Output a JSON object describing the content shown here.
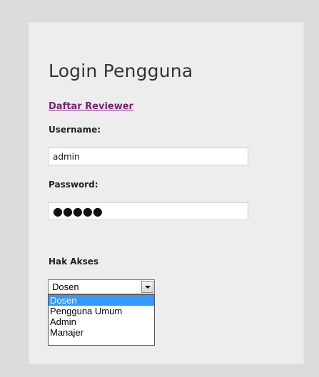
{
  "login": {
    "title": "Login Pengguna",
    "register_link": "Daftar Reviewer",
    "username_label": "Username:",
    "username_value": "admin",
    "password_label": "Password:",
    "password_mask": "●●●●●",
    "role_label": "Hak Akses",
    "role_selected": "Dosen",
    "role_options": [
      "Dosen",
      "Pengguna Umum",
      "Admin",
      "Manajer"
    ]
  },
  "colors": {
    "page_bg": "#dcdcdc",
    "panel_bg": "#ededed",
    "link": "#7a1f7a",
    "option_highlight": "#3399ff"
  }
}
